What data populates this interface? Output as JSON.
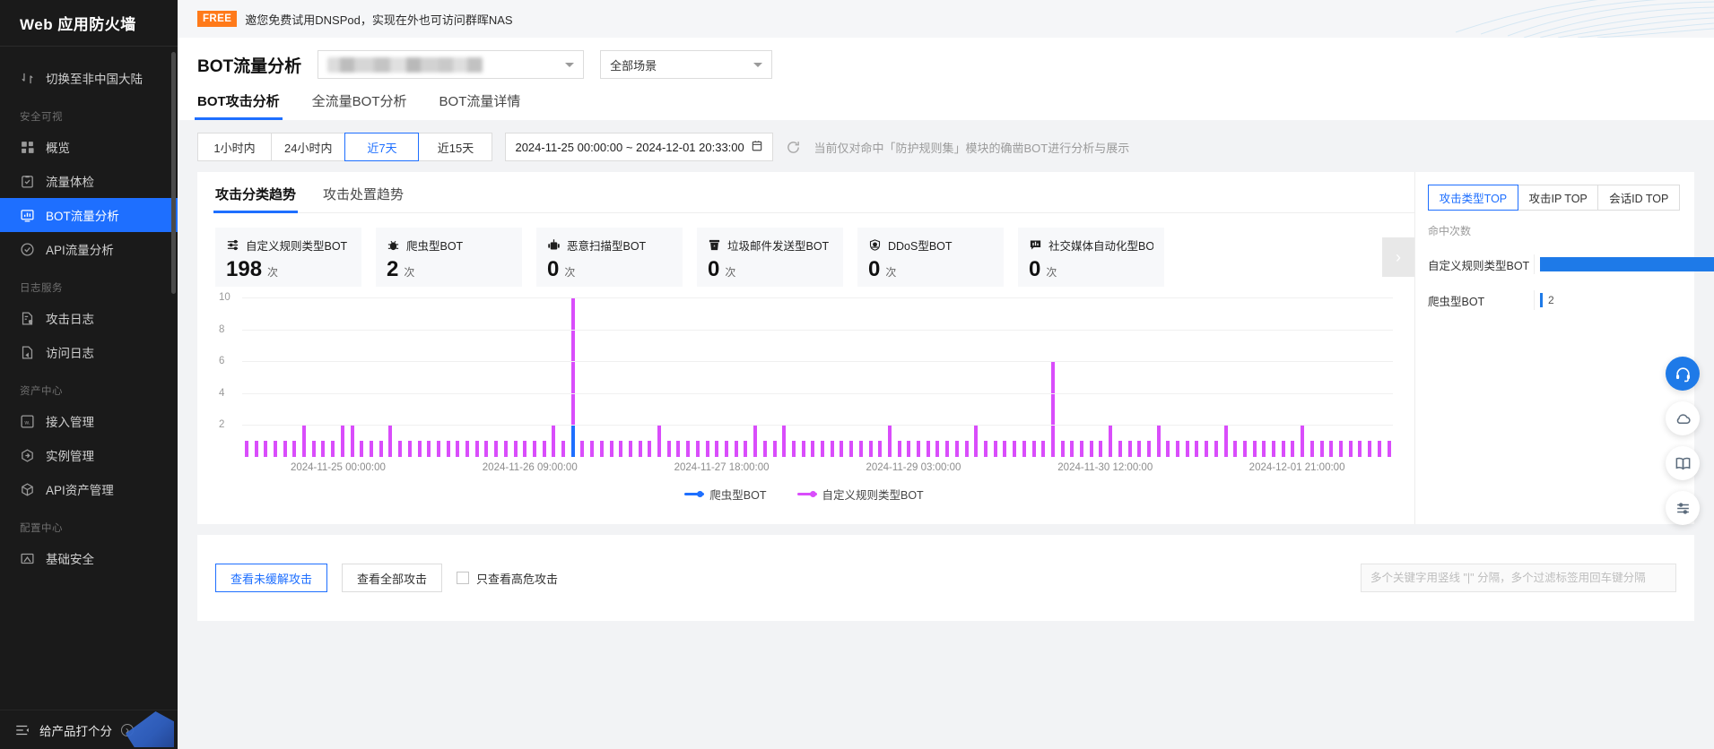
{
  "sidebar": {
    "title": "Web 应用防火墙",
    "switch_item": {
      "label": "切换至非中国大陆",
      "icon": "switch-region-icon"
    },
    "groups": [
      {
        "label": "安全可视",
        "items": [
          {
            "label": "概览",
            "icon": "grid-icon",
            "active": false
          },
          {
            "label": "流量体检",
            "icon": "clipboard-check-icon",
            "active": false
          },
          {
            "label": "BOT流量分析",
            "icon": "monitor-chart-icon",
            "active": true
          },
          {
            "label": "API流量分析",
            "icon": "circle-check-icon",
            "active": false
          }
        ]
      },
      {
        "label": "日志服务",
        "items": [
          {
            "label": "攻击日志",
            "icon": "file-shield-icon",
            "active": false
          },
          {
            "label": "访问日志",
            "icon": "file-arrow-icon",
            "active": false
          }
        ]
      },
      {
        "label": "资产中心",
        "items": [
          {
            "label": "接入管理",
            "icon": "web-square-icon",
            "active": false
          },
          {
            "label": "实例管理",
            "icon": "instance-icon",
            "active": false
          },
          {
            "label": "API资产管理",
            "icon": "cube-icon",
            "active": false
          }
        ]
      },
      {
        "label": "配置中心",
        "items": [
          {
            "label": "基础安全",
            "icon": "shield-basic-icon",
            "active": false
          }
        ]
      }
    ],
    "rate_product": {
      "label": "给产品打个分",
      "icon": "collapse-menu-icon",
      "chevron": "›"
    }
  },
  "promo": {
    "badge": "FREE",
    "text": "邀您免费试用DNSPod，实现在外也可访问群晖NAS"
  },
  "header": {
    "page_title": "BOT流量分析",
    "domain_select_value": "",
    "scene_select_value": "全部场景",
    "tabs": [
      {
        "label": "BOT攻击分析",
        "active": true
      },
      {
        "label": "全流量BOT分析",
        "active": false
      },
      {
        "label": "BOT流量详情",
        "active": false
      }
    ]
  },
  "timebar": {
    "ranges": [
      {
        "label": "1小时内",
        "active": false
      },
      {
        "label": "24小时内",
        "active": false
      },
      {
        "label": "近7天",
        "active": true
      },
      {
        "label": "近15天",
        "active": false
      }
    ],
    "date_range": "2024-11-25 00:00:00  ~ 2024-12-01 20:33:00",
    "calendar_icon": "calendar-icon",
    "refresh_icon": "refresh-icon",
    "hint": "当前仅对命中「防护规则集」模块的确凿BOT进行分析与展示"
  },
  "panel": {
    "sub_tabs": [
      {
        "label": "攻击分类趋势",
        "active": true
      },
      {
        "label": "攻击处置趋势",
        "active": false
      }
    ],
    "cards": [
      {
        "name": "自定义规则类型BOT",
        "value": "198",
        "unit": "次",
        "icon": "sliders-icon"
      },
      {
        "name": "爬虫型BOT",
        "value": "2",
        "unit": "次",
        "icon": "bug-icon"
      },
      {
        "name": "恶意扫描型BOT",
        "value": "0",
        "unit": "次",
        "icon": "robot-icon"
      },
      {
        "name": "垃圾邮件发送型BOT",
        "value": "0",
        "unit": "次",
        "icon": "trash-mail-icon"
      },
      {
        "name": "DDoS型BOT",
        "value": "0",
        "unit": "次",
        "icon": "shield-ddos-icon"
      },
      {
        "name": "社交媒体自动化型BOT",
        "value": "0",
        "unit": "次",
        "icon": "chat-chart-icon"
      }
    ],
    "cards_next_icon": "chevron-right-icon"
  },
  "right_panel": {
    "tabs": [
      {
        "label": "攻击类型TOP",
        "active": true
      },
      {
        "label": "攻击IP TOP",
        "active": false
      },
      {
        "label": "会话ID TOP",
        "active": false
      }
    ],
    "axis_label": "命中次数",
    "rows": [
      {
        "name": "自定义规则类型BOT",
        "value": "",
        "ratio": 1.0
      },
      {
        "name": "爬虫型BOT",
        "value": "2",
        "ratio": 0.012
      }
    ]
  },
  "bottom": {
    "btn_unmitigated": "查看未缓解攻击",
    "btn_all": "查看全部攻击",
    "checkbox_label": "只查看高危攻击",
    "search_placeholder": "多个关键字用竖线 \"|\" 分隔，多个过滤标签用回车键分隔"
  },
  "fabs": [
    {
      "icon": "headset-icon",
      "primary": true
    },
    {
      "icon": "cloud-icon",
      "primary": false
    },
    {
      "icon": "book-icon",
      "primary": false
    },
    {
      "icon": "list-settings-icon",
      "primary": false
    }
  ],
  "chart_data": {
    "type": "bar",
    "title": "攻击分类趋势",
    "xlabel": "",
    "ylabel": "",
    "ylim": [
      0,
      10
    ],
    "yticks": [
      2,
      4,
      6,
      8,
      10
    ],
    "grid": true,
    "legend_position": "bottom",
    "xticks": [
      "2024-11-25 00:00:00",
      "2024-11-26 09:00:00",
      "2024-11-27 18:00:00",
      "2024-11-29 03:00:00",
      "2024-11-30 12:00:00",
      "2024-12-01 21:00:00"
    ],
    "series": [
      {
        "name": "爬虫型BOT",
        "color": "#1e6fff",
        "values": [
          0,
          0,
          0,
          0,
          0,
          0,
          0,
          0,
          0,
          0,
          0,
          0,
          0,
          0,
          0,
          0,
          0,
          0,
          0,
          0,
          0,
          0,
          0,
          0,
          0,
          0,
          0,
          0,
          0,
          0,
          0,
          0,
          0,
          0,
          2,
          0,
          0,
          0,
          0,
          0,
          0,
          0,
          0,
          0,
          0,
          0,
          0,
          0,
          0,
          0,
          0,
          0,
          0,
          0,
          0,
          0,
          0,
          0,
          0,
          0,
          0,
          0,
          0,
          0,
          0,
          0,
          0,
          0,
          0,
          0,
          0,
          0,
          0,
          0,
          0,
          0,
          0,
          0,
          0,
          0,
          0,
          0,
          0,
          0,
          0,
          0,
          0,
          0,
          0,
          0,
          0,
          0,
          0,
          0,
          0,
          0,
          0,
          0,
          0,
          0
        ]
      },
      {
        "name": "自定义规则类型BOT",
        "color": "#d94dfb",
        "values": [
          1,
          1,
          1,
          1,
          1,
          1,
          2,
          1,
          1,
          1,
          2,
          2,
          1,
          1,
          1,
          2,
          1,
          1,
          1,
          1,
          1,
          1,
          1,
          1,
          1,
          1,
          1,
          1,
          1,
          1,
          1,
          1,
          2,
          1,
          10,
          1,
          1,
          1,
          1,
          1,
          1,
          1,
          1,
          2,
          1,
          1,
          1,
          1,
          1,
          1,
          1,
          1,
          1,
          2,
          1,
          1,
          2,
          1,
          1,
          1,
          1,
          1,
          1,
          1,
          1,
          1,
          1,
          2,
          1,
          1,
          1,
          1,
          1,
          1,
          1,
          1,
          2,
          1,
          1,
          1,
          1,
          1,
          1,
          1,
          6,
          1,
          1,
          1,
          1,
          1,
          2,
          1,
          1,
          1,
          1,
          2,
          1,
          1,
          1,
          1,
          1,
          1,
          2,
          1,
          1,
          1,
          1,
          1,
          1,
          1,
          2,
          1,
          1,
          1,
          1,
          1,
          1,
          1,
          1,
          1
        ]
      }
    ]
  }
}
